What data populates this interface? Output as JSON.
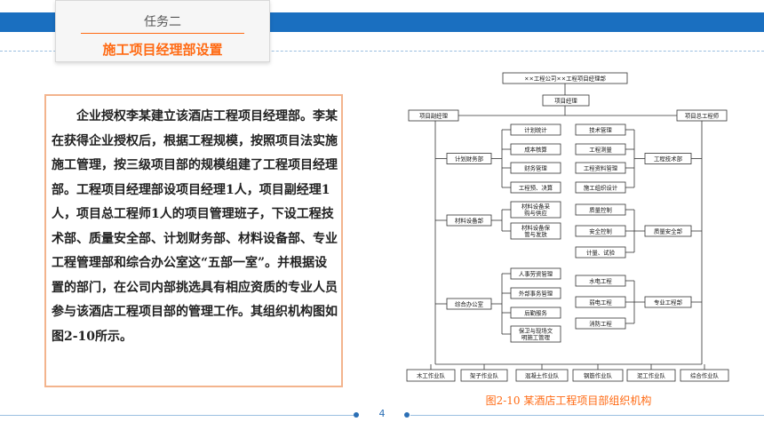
{
  "header": {
    "task_label": "任务二",
    "section_title": "施工项目经理部设置"
  },
  "body": {
    "paragraph": "企业授权李某建立该酒店工程项目经理部。李某在获得企业授权后，根据工程规模，按照项目法实施施工管理，按三级项目部的规模组建了工程项目经理部。工程项目经理部设项目经理1人，项目副经理1人，项目总工程师1人的项目管理班子，下设工程技术部、质量安全部、计划财务部、材料设备部、专业工程管理部和综合办公室这“五部一室”。并根据设置的部门，在公司内部挑选具有相应资质的专业人员参与该酒店工程项目部的管理工作。其组织机构图如图2-10所示。"
  },
  "org_chart": {
    "top": "××工程公司××工程项目经理部",
    "manager": "项目经理",
    "deputy": "项目副经理",
    "chief_engineer": "项目总工程师",
    "left_departments": [
      "计划财务部",
      "材料设备部",
      "综合办公室"
    ],
    "right_departments": [
      "工程技术部",
      "质量安全部",
      "专业工程部"
    ],
    "left_functions": [
      [
        "计划统计",
        "成本核算",
        "财务管理",
        "工程预、决算"
      ],
      [
        "材料设备采购与供应",
        "材料设备保管与发放"
      ],
      [
        "人事劳资管理",
        "外部事务管理",
        "后勤服务",
        "保卫与现场文明施工管理"
      ]
    ],
    "right_functions": [
      [
        "技术管理",
        "工程测量",
        "工程资料管理",
        "施工组织设计"
      ],
      [
        "质量控制",
        "安全控制",
        "计量、试验"
      ],
      [
        "水电工程",
        "弱电工程",
        "消防工程"
      ]
    ],
    "teams": [
      "木工作业队",
      "架子作业队",
      "混凝土作业队",
      "钢筋作业队",
      "泥工作业队",
      "综合作业队"
    ],
    "caption": "图2-10  某酒店工程项目部组织机构"
  },
  "footer": {
    "page_number": "4"
  }
}
